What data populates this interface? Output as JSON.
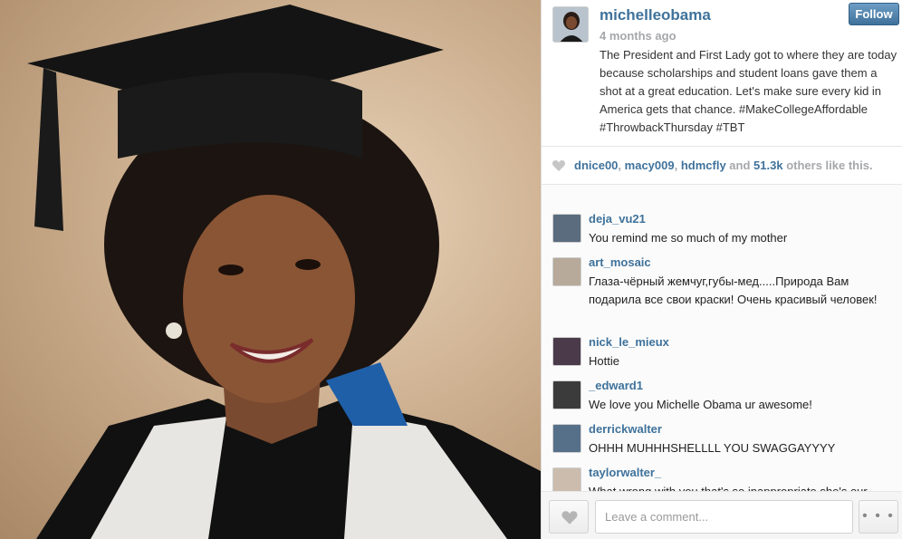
{
  "post": {
    "owner": "michelleobama",
    "time_ago": "4 months ago",
    "follow_label": "Follow",
    "caption": "The President and First Lady got to where they are today because scholarships and student loans gave them a shot at a great education. Let's make sure every kid in America gets that chance. #MakeCollegeAffordable #ThrowbackThursday #TBT"
  },
  "likes": {
    "icon": "heart-icon",
    "users": [
      "dnice00",
      "macy009",
      "hdmcfly"
    ],
    "sep": ", ",
    "and_text": " and ",
    "count": "51.3k",
    "suffix": " others like this."
  },
  "comments": [
    {
      "user": "deja_vu21",
      "text": "You remind me so much of my mother",
      "avatar_color": "#5a6c7e"
    },
    {
      "user": "art_mosaic",
      "text": "Глаза-чёрный жемчуг,губы-мед.....Природа Вам подарила все свои краски! Очень красивый человек!",
      "avatar_color": "#b7aa9a"
    },
    {
      "user": "nick_le_mieux",
      "text": "Hottie",
      "avatar_color": "#4a3a4a"
    },
    {
      "user": "_edward1",
      "text": "We love you Michelle Obama ur awesome!",
      "avatar_color": "#3b3b3b"
    },
    {
      "user": "derrickwalter",
      "text": "OHHH MUHHHSHELLLL YOU SWAGGAYYYY",
      "avatar_color": "#56708a"
    },
    {
      "user": "taylorwalter_",
      "text": "What wrong with you that's so inappropriate she's our",
      "avatar_color": "#cbbcae"
    }
  ],
  "footer": {
    "comment_placeholder": "Leave a comment...",
    "more_label": "• • •"
  }
}
